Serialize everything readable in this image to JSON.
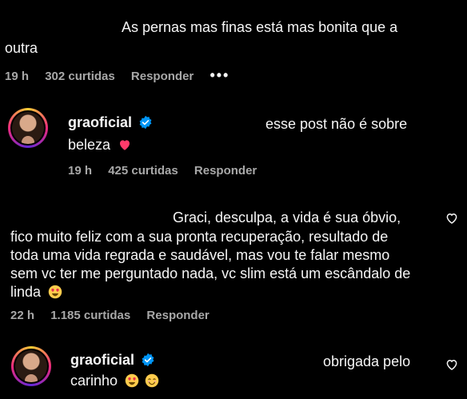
{
  "comment1": {
    "text_line1": "As pernas mas finas está mas bonita que a",
    "text_line2": "outra",
    "time": "19 h",
    "likes": "302 curtidas",
    "reply": "Responder",
    "more": "•••"
  },
  "reply1": {
    "username": "graoficial",
    "text_line1": "esse post não é sobre",
    "text_line2": "beleza",
    "time": "19 h",
    "likes": "425 curtidas",
    "reply": "Responder"
  },
  "comment2": {
    "lines": [
      "Graci, desculpa, a vida é sua óbvio,",
      "fico muito feliz com a sua pronta recuperação, resultado de",
      "toda uma vida regrada e saudável, mas vou te falar mesmo",
      "sem vc ter me perguntado nada, vc slim está um escândalo de",
      "linda"
    ],
    "time": "22 h",
    "likes": "1.185 curtidas",
    "reply": "Responder"
  },
  "reply2": {
    "username": "graoficial",
    "text_line1": "obrigada pelo",
    "text_line2": "carinho"
  },
  "colors": {
    "background": "#000000",
    "text": "#f5f5f5",
    "meta": "#a8a8a8",
    "verified": "#0095f6",
    "heart": "#ff3b6b"
  },
  "icons": [
    "more-icon",
    "verified-icon",
    "heart-emoji",
    "heart-eyes-emoji",
    "smiling-face-emoji",
    "like-heart-icon"
  ]
}
